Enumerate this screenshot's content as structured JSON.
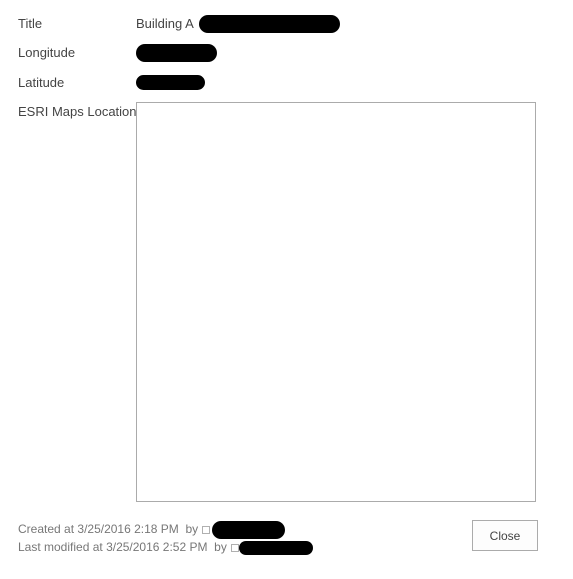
{
  "fields": {
    "title": {
      "label": "Title",
      "value": "Building A"
    },
    "longitude": {
      "label": "Longitude",
      "value": ""
    },
    "latitude": {
      "label": "Latitude",
      "value": ""
    },
    "map": {
      "label": "ESRI Maps Location"
    }
  },
  "footer": {
    "created_prefix": "Created at",
    "created_time": "3/25/2016 2:18 PM",
    "by": "by",
    "modified_prefix": "Last modified at",
    "modified_time": "3/25/2016 2:52 PM",
    "user_icon": "user-presence-icon"
  },
  "actions": {
    "close_label": "Close"
  },
  "colors": {
    "text": "#444444",
    "muted_text": "#777777",
    "border": "#ababab",
    "redaction": "#000000"
  }
}
